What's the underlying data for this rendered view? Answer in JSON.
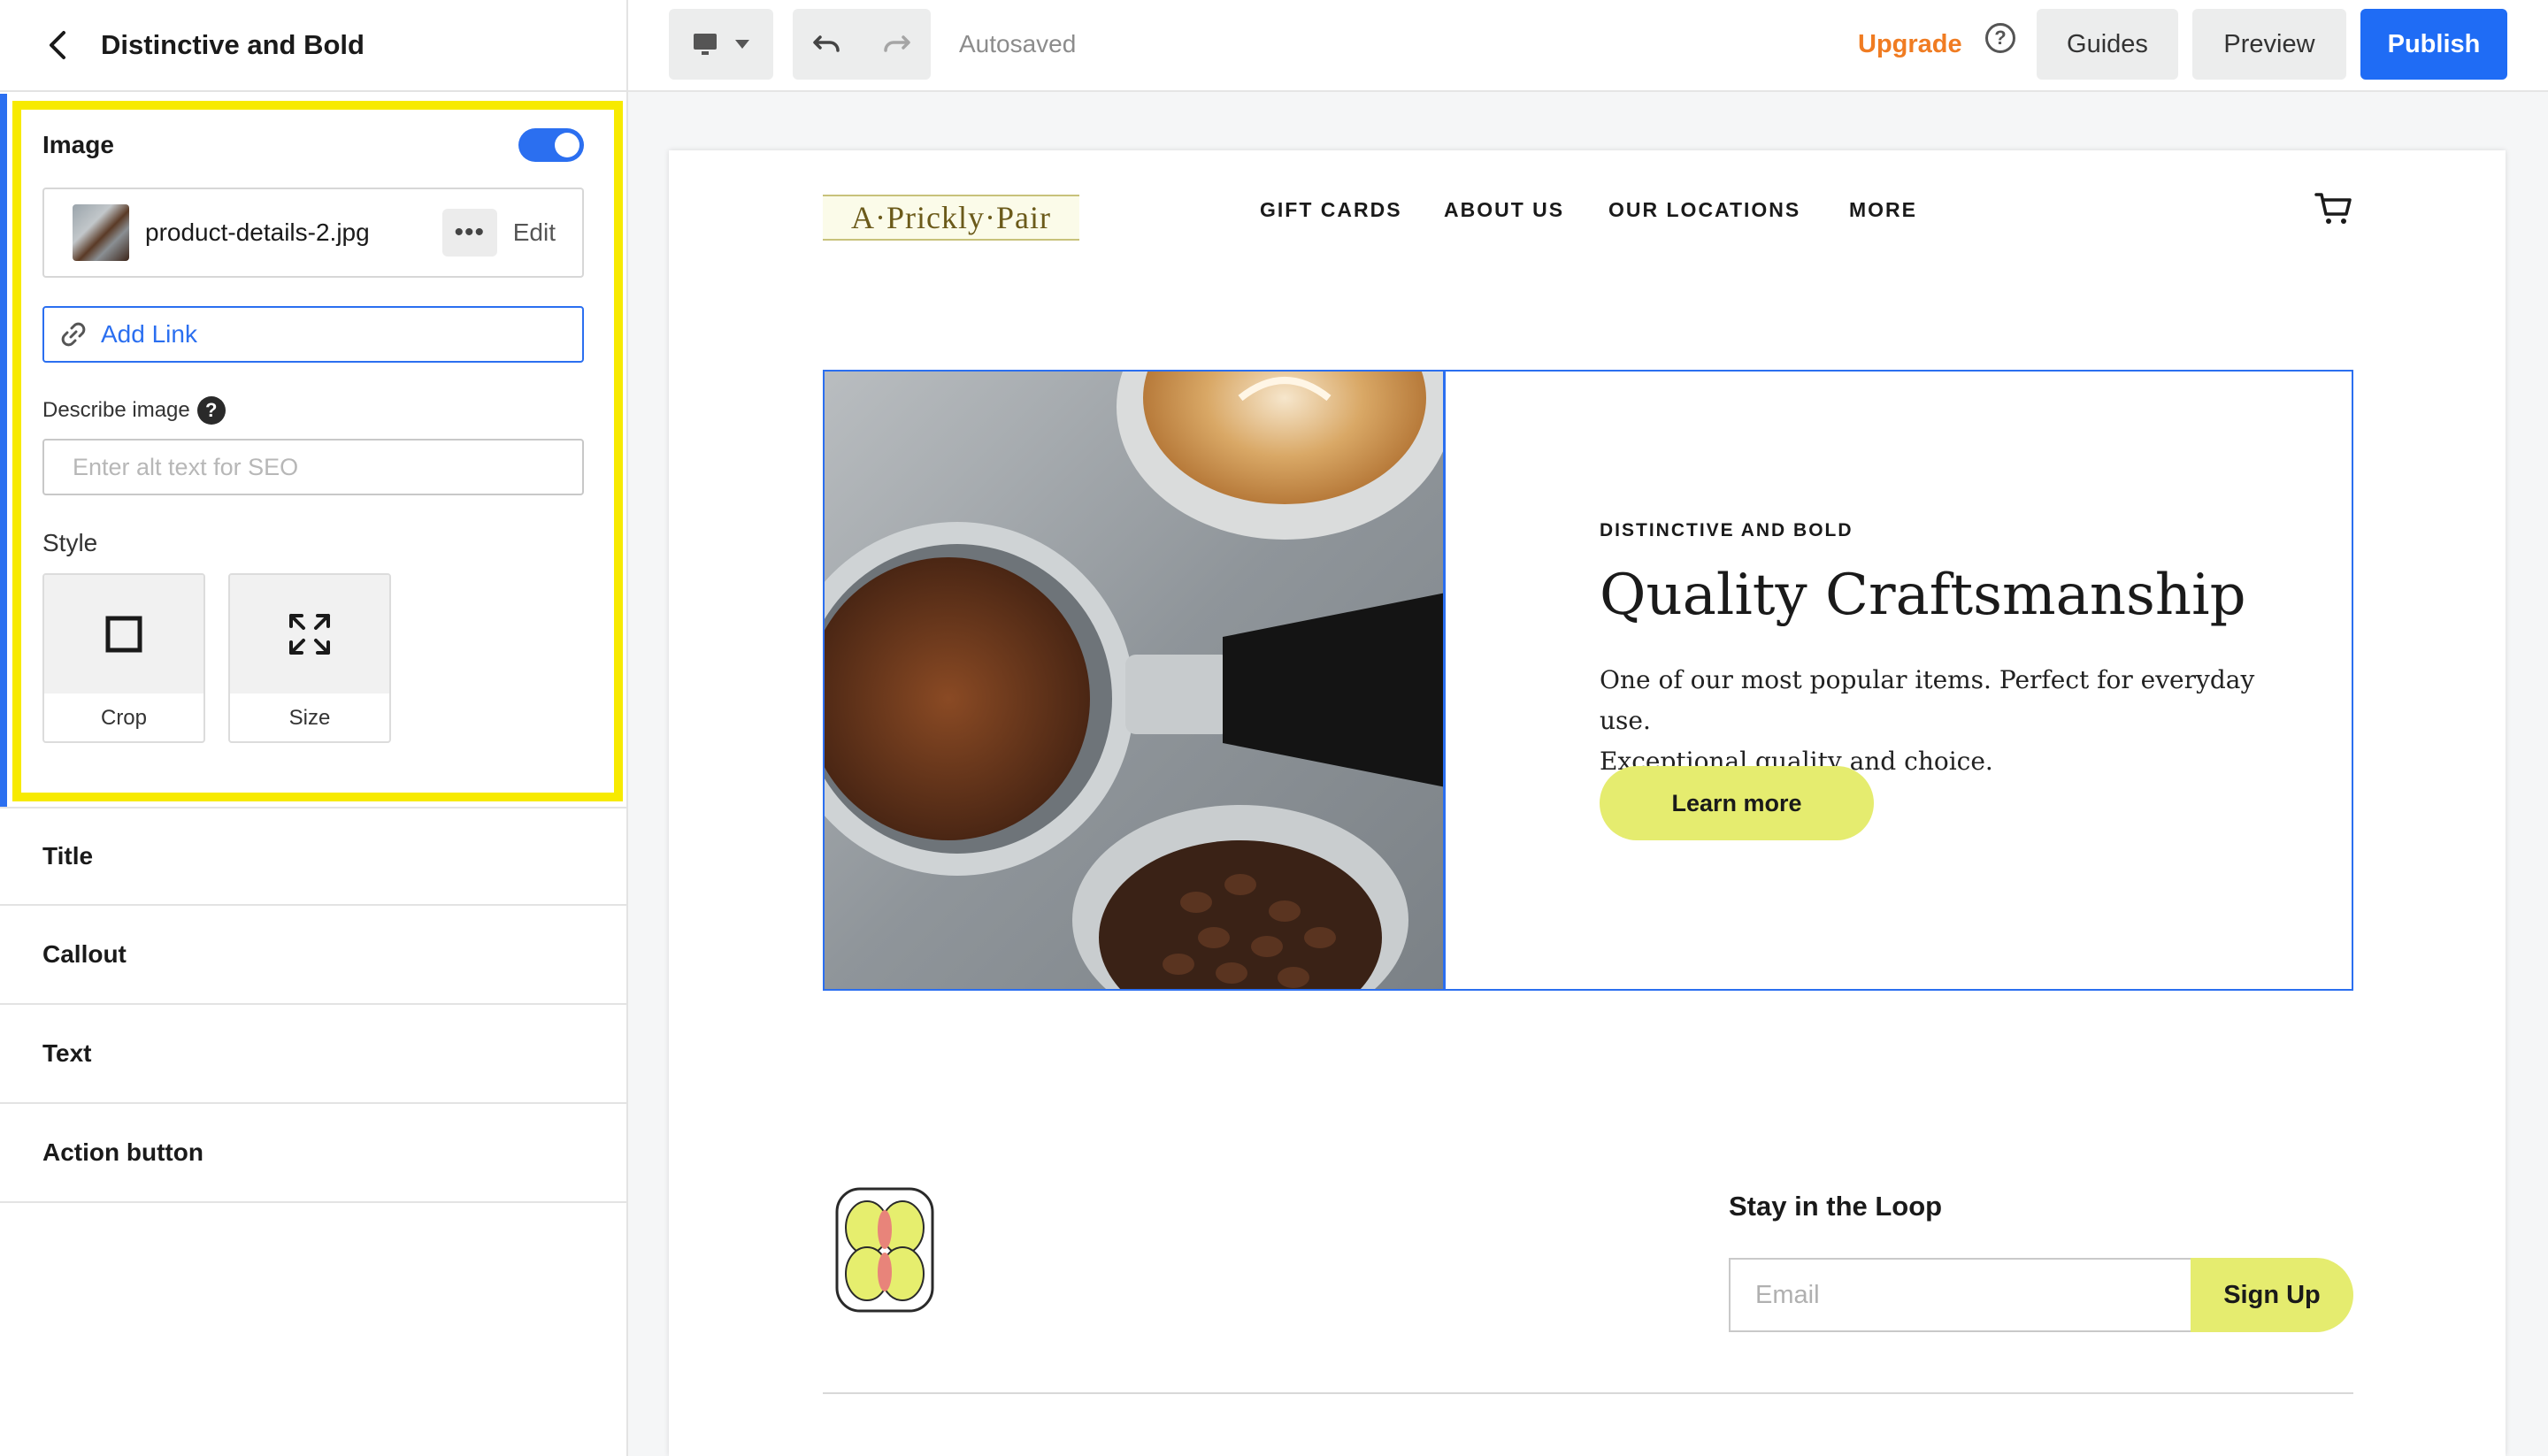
{
  "sidebar": {
    "header_title": "Distinctive and Bold",
    "image_section": {
      "label": "Image",
      "toggle_on": true,
      "filename": "product-details-2.jpg",
      "more_label": "•••",
      "edit_label": "Edit",
      "add_link_label": "Add Link",
      "describe_label": "Describe image",
      "help_glyph": "?",
      "alt_placeholder": "Enter alt text for SEO",
      "style_label": "Style",
      "style_options": [
        {
          "label": "Crop",
          "icon": "crop-square-icon"
        },
        {
          "label": "Size",
          "icon": "expand-arrows-icon"
        }
      ]
    },
    "sections": [
      "Title",
      "Callout",
      "Text",
      "Action button"
    ]
  },
  "topbar": {
    "autosaved": "Autosaved",
    "upgrade": "Upgrade",
    "help_glyph": "?",
    "guides": "Guides",
    "preview": "Preview",
    "publish": "Publish"
  },
  "site": {
    "logo_text": "A·Prickly·Pair",
    "nav": [
      "GIFT CARDS",
      "ABOUT US",
      "OUR LOCATIONS",
      "MORE"
    ],
    "feature": {
      "eyebrow": "DISTINCTIVE AND BOLD",
      "heading": "Quality Craftsmanship",
      "body_line1": "One of our most popular items. Perfect for everyday use.",
      "body_line2": "Exceptional quality and choice.",
      "button": "Learn more"
    },
    "footer": {
      "stay_title": "Stay in the Loop",
      "email_placeholder": "Email",
      "signup": "Sign Up"
    }
  },
  "colors": {
    "accent_blue": "#1f6cf5",
    "highlight_yellow": "#f7ea00",
    "upgrade_orange": "#f07c22",
    "button_lime": "#e5ec6f"
  }
}
